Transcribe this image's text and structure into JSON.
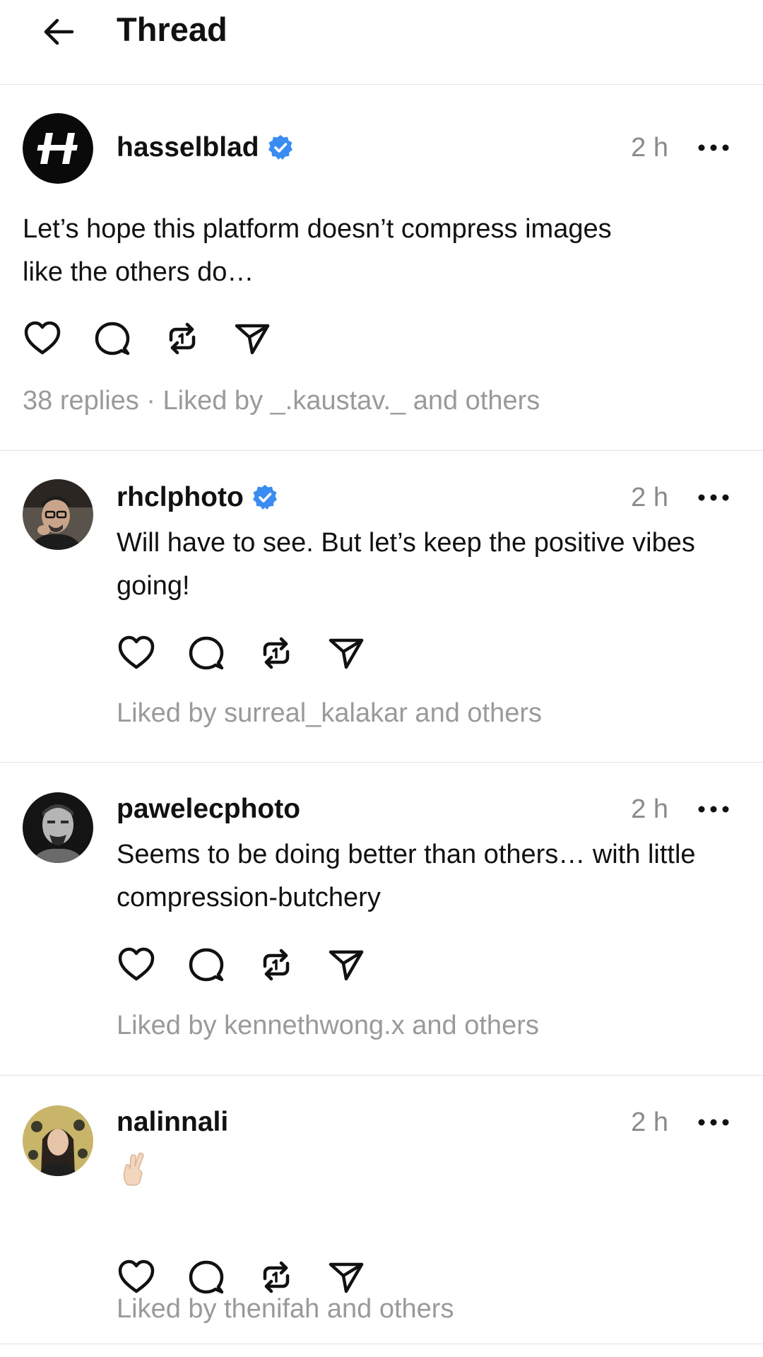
{
  "header": {
    "title": "Thread",
    "back_icon": "arrow-left-icon"
  },
  "colors": {
    "verified": "#3b8cf0",
    "meta_text": "#9a9a9a",
    "divider": "#e4e4e4"
  },
  "posts": [
    {
      "username": "hasselblad",
      "verified": true,
      "time": "2 h",
      "text": "Let’s hope this platform doesn’t compress images\nlike the others do…",
      "meta": "38 replies · Liked by _.kaustav._ and others"
    },
    {
      "username": "rhclphoto",
      "verified": true,
      "time": "2 h",
      "text": "Will have to see. But let’s keep the positive vibes\ngoing!",
      "meta": "Liked by surreal_kalakar and others"
    },
    {
      "username": "pawelecphoto",
      "verified": false,
      "time": "2 h",
      "text": "Seems to be doing better than others… with little\ncompression-butchery",
      "meta": "Liked by kennethwong.x and others"
    },
    {
      "username": "nalinnali",
      "verified": false,
      "time": "2 h",
      "text": "🤞🏻",
      "meta": "Liked by thenifah and others"
    }
  ]
}
